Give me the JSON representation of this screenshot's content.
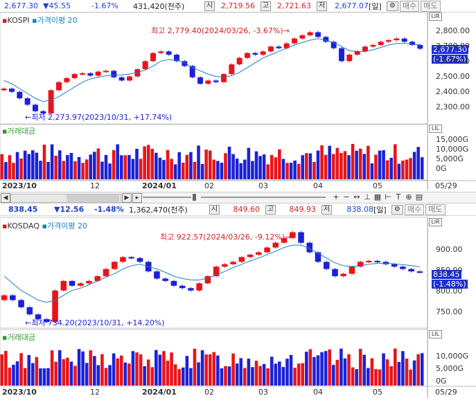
{
  "top_quote": {
    "price": "2,677.30",
    "change": "▼45.55",
    "change_pct": "-1.67%",
    "volume": "431,420(천주)",
    "open_label": "시",
    "open": "2,719.56",
    "high_label": "고",
    "high": "2,721.63",
    "low_label": "저",
    "low": "2,677.07",
    "period": "[일]",
    "buy_label": "매수",
    "sell_label": "매도"
  },
  "kospi": {
    "name": "KOSPI",
    "indicator": "가격이평 20",
    "max_label": "최고 2,779.40(2024/03/26, -3.67%)→",
    "min_label": "←최저 2,273.97(2023/10/31, +17.74%)",
    "price_box": "2,677.30",
    "pct_box": "(-1.67%)",
    "y_ticks": [
      "2,800.00",
      "2,700.00",
      "2,600.00",
      "2,500.00",
      "2,400.00",
      "2,300.00"
    ],
    "vol_legend": "거래대금",
    "vol_ticks": [
      "15,000G",
      "10,000G",
      "5,000G",
      "0G"
    ],
    "x_labels": [
      "2023/10",
      "12",
      "2024/01",
      "02",
      "03",
      "04",
      "05",
      "05/29"
    ]
  },
  "mid_quote": {
    "price": "838.45",
    "change": "▼12.56",
    "change_pct": "-1.48%",
    "volume": "1,362,470(천주)",
    "open_label": "시",
    "open": "849.60",
    "high_label": "고",
    "high": "849.93",
    "low_label": "저",
    "low": "838.08",
    "period": "[일]",
    "buy_label": "매수",
    "sell_label": "매도"
  },
  "kosdaq": {
    "name": "KOSDAQ",
    "indicator": "가격이평 20",
    "max_label": "최고 922.57(2024/03/26, -9.12%)→",
    "min_label": "←최저 734.20(2023/10/31, +14.20%)",
    "price_box": "838.45",
    "pct_box": "(-1.48%)",
    "y_ticks": [
      "900.00",
      "850.00",
      "800.00",
      "750.00"
    ],
    "vol_legend": "거래대금",
    "vol_ticks": [
      "10,000G",
      "5,000G",
      "0G"
    ],
    "x_labels": [
      "2023/10",
      "12",
      "2024/01",
      "02",
      "03",
      "04",
      "05",
      "05/29"
    ]
  },
  "toolbar": {
    "zoom_in": "+",
    "zoom_out": "−",
    "move": "↔",
    "text_tool": "T",
    "save": "💾"
  },
  "colors": {
    "up": "#e8141b",
    "down": "#1c21d6",
    "ma": "#1a7fc0",
    "price_box": "#1d2fd6"
  },
  "chart_data": [
    {
      "type": "line",
      "title": "KOSPI",
      "series": [
        {
          "name": "KOSPI",
          "values": [
            2430,
            2410,
            2370,
            2330,
            2290,
            2276,
            2420,
            2470,
            2495,
            2520,
            2525,
            2510,
            2535,
            2540,
            2500,
            2480,
            2505,
            2550,
            2600,
            2650,
            2660,
            2640,
            2600,
            2570,
            2500,
            2460,
            2480,
            2470,
            2520,
            2580,
            2620,
            2650,
            2640,
            2660,
            2690,
            2680,
            2710,
            2740,
            2760,
            2779,
            2750,
            2720,
            2680,
            2600,
            2640,
            2660,
            2690,
            2700,
            2720,
            2730,
            2740,
            2720,
            2700,
            2677
          ]
        },
        {
          "name": "가격이평 20",
          "values": [
            2480,
            2460,
            2430,
            2400,
            2370,
            2350,
            2360,
            2380,
            2410,
            2440,
            2470,
            2490,
            2500,
            2510,
            2515,
            2515,
            2520,
            2530,
            2545,
            2570,
            2600,
            2610,
            2605,
            2590,
            2560,
            2540,
            2520,
            2505,
            2500,
            2510,
            2530,
            2560,
            2590,
            2620,
            2640,
            2660,
            2680,
            2700,
            2715,
            2730,
            2740,
            2730,
            2715,
            2690,
            2665,
            2660,
            2660,
            2670,
            2685,
            2700,
            2710,
            2710,
            2705,
            2700
          ]
        }
      ],
      "ylim": [
        2250,
        2850
      ]
    },
    {
      "type": "line",
      "title": "KOSDAQ",
      "series": [
        {
          "name": "KOSDAQ",
          "values": [
            790,
            780,
            765,
            750,
            740,
            734,
            800,
            820,
            810,
            815,
            820,
            830,
            845,
            860,
            870,
            868,
            860,
            840,
            825,
            820,
            810,
            805,
            800,
            815,
            830,
            850,
            855,
            860,
            870,
            875,
            880,
            890,
            900,
            910,
            922,
            900,
            880,
            860,
            845,
            830,
            835,
            850,
            860,
            862,
            860,
            855,
            850,
            845,
            840,
            838
          ]
        },
        {
          "name": "가격이평 20",
          "values": [
            830,
            815,
            800,
            790,
            780,
            775,
            780,
            790,
            800,
            805,
            812,
            820,
            828,
            835,
            845,
            852,
            855,
            850,
            845,
            838,
            830,
            825,
            822,
            822,
            826,
            832,
            840,
            848,
            855,
            862,
            868,
            875,
            882,
            890,
            895,
            895,
            888,
            878,
            868,
            858,
            852,
            850,
            852,
            855,
            857,
            857,
            856,
            854,
            852,
            850
          ]
        }
      ],
      "ylim": [
        730,
        930
      ]
    }
  ]
}
